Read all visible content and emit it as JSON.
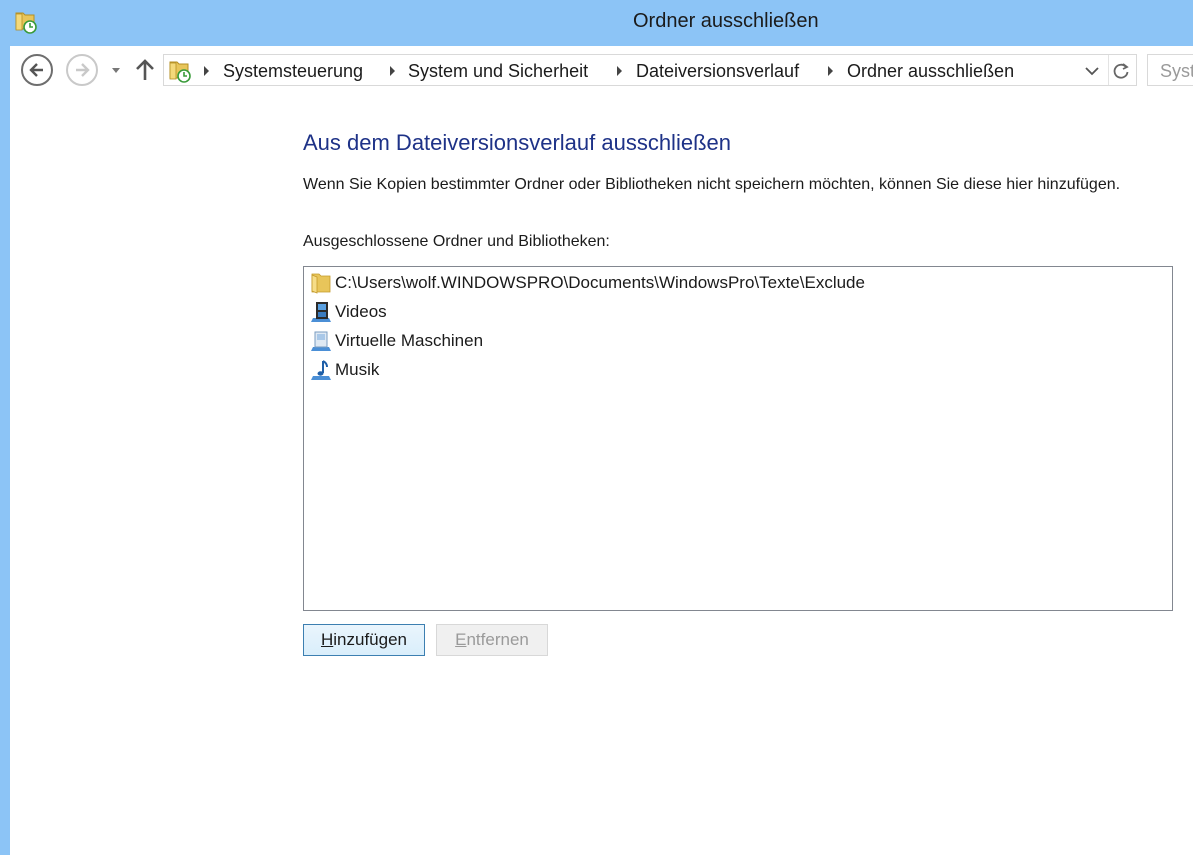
{
  "window": {
    "title": "Ordner ausschließen",
    "icon": "file-history-folder-icon"
  },
  "navigation": {
    "back_icon": "back-arrow-icon",
    "forward_icon": "forward-arrow-icon",
    "recent_icon": "chevron-down-icon",
    "up_icon": "up-arrow-icon",
    "address_icon": "file-history-folder-icon",
    "breadcrumbs": [
      "Systemsteuerung",
      "System und Sicherheit",
      "Dateiversionsverlauf",
      "Ordner ausschließen"
    ],
    "refresh_icon": "refresh-icon",
    "search_placeholder": "Syst"
  },
  "main": {
    "heading": "Aus dem Dateiversionsverlauf ausschließen",
    "description": "Wenn Sie Kopien bestimmter Ordner oder Bibliotheken nicht speichern möchten, können Sie diese hier hinzufügen.",
    "list_label": "Ausgeschlossene Ordner und Bibliotheken:",
    "excluded_items": [
      {
        "label": "C:\\Users\\wolf.WINDOWSPRO\\Documents\\WindowsPro\\Texte\\Exclude",
        "icon": "folder-icon"
      },
      {
        "label": "Videos",
        "icon": "videos-library-icon"
      },
      {
        "label": "Virtuelle Maschinen",
        "icon": "library-icon"
      },
      {
        "label": "Musik",
        "icon": "music-library-icon"
      }
    ],
    "add_button": {
      "accesskey": "H",
      "rest": "inzufügen"
    },
    "remove_button": {
      "accesskey": "E",
      "rest": "ntfernen"
    }
  },
  "colors": {
    "titlebar": "#8cc4f6",
    "heading": "#1e3287",
    "button_border_active": "#3c7fb1",
    "button_disabled_text": "#9a9a9a"
  }
}
